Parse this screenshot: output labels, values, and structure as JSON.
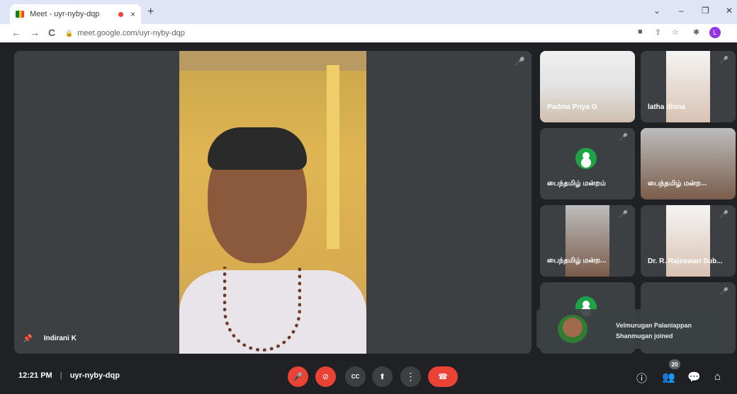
{
  "browser": {
    "tab_title": "Meet - uyr-nyby-dqp",
    "tab_close": "×",
    "new_tab": "+",
    "url": "meet.google.com/uyr-nyby-dqp",
    "profile_initial": "L",
    "window": {
      "tabsearch": "⌄",
      "minimize": "–",
      "maximize": "❐",
      "close": "✕"
    },
    "nav": {
      "back": "←",
      "forward": "→",
      "reload": "C"
    }
  },
  "meeting": {
    "main_speaker": "Indirani K",
    "time": "12:21 PM",
    "separator": "|",
    "meeting_code": "uyr-nyby-dqp",
    "participant_count": "20"
  },
  "participants": [
    {
      "name": "Padma Priya G",
      "video": "camera"
    },
    {
      "name": "latha dhina",
      "video": "camera"
    },
    {
      "name": "பைந்தமிழ் மன்றம்",
      "video": "avatar"
    },
    {
      "name": "பைந்தமிழ் மன்ற...",
      "video": "camera"
    },
    {
      "name": "பைந்தமிழ் மன்ற...",
      "video": "camera"
    },
    {
      "name": "Dr. R. Rajeswari Sub...",
      "video": "camera"
    },
    {
      "name": "",
      "video": "others"
    },
    {
      "name": "",
      "video": "you"
    }
  ],
  "notification": {
    "line1": "Velmurugan Palaniappan",
    "line2": "Shanmugan joined"
  },
  "controls": {
    "mic": "mic-off-icon",
    "camera": "videocam-off-icon",
    "captions": "captions-icon",
    "present": "present-icon",
    "more": "more-vert-icon",
    "leave": "call-end-icon"
  },
  "icons": {
    "mic": "🎤",
    "cam": "⊘",
    "cc": "CC",
    "present": "⬆",
    "more": "⋮",
    "end": "☎",
    "pin": "📌",
    "mute": "🎤",
    "info": "ⓘ",
    "people": "👥",
    "chat": "💬",
    "activities": "⌂",
    "lock": "🔒",
    "cast": "■",
    "share": "⇪",
    "star": "☆",
    "extension": "✱"
  },
  "colors": {
    "meet_bg": "#202124",
    "tile_bg": "#3c4043",
    "danger": "#ea4335",
    "avatar_green": "#1ea446"
  }
}
